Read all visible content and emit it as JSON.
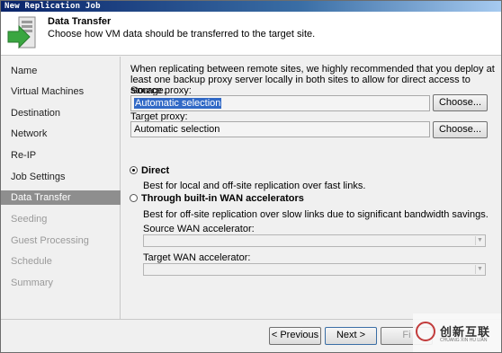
{
  "window": {
    "title": "New Replication Job"
  },
  "header": {
    "title": "Data Transfer",
    "subtitle": "Choose how VM data should be transferred to the target site."
  },
  "sidebar": {
    "items": [
      {
        "label": "Name",
        "state": "normal"
      },
      {
        "label": "Virtual Machines",
        "state": "normal"
      },
      {
        "label": "Destination",
        "state": "normal"
      },
      {
        "label": "Network",
        "state": "normal"
      },
      {
        "label": "Re-IP",
        "state": "normal"
      },
      {
        "label": "Job Settings",
        "state": "normal"
      },
      {
        "label": "Data Transfer",
        "state": "active"
      },
      {
        "label": "Seeding",
        "state": "disabled"
      },
      {
        "label": "Guest Processing",
        "state": "disabled"
      },
      {
        "label": "Schedule",
        "state": "disabled"
      },
      {
        "label": "Summary",
        "state": "disabled"
      }
    ]
  },
  "main": {
    "description": "When replicating between remote sites, we highly recommended that you deploy at least one backup proxy server locally in both sites to allow for direct access to storage.",
    "source_proxy": {
      "label": "Source proxy:",
      "value": "Automatic selection",
      "button": "Choose..."
    },
    "target_proxy": {
      "label": "Target proxy:",
      "value": "Automatic selection",
      "button": "Choose..."
    },
    "direct": {
      "label": "Direct",
      "desc": "Best for local and off-site replication over fast links.",
      "checked": true
    },
    "wan": {
      "label": "Through built-in WAN accelerators",
      "desc": "Best for off-site replication over slow links due to significant bandwidth savings.",
      "checked": false
    },
    "source_wan": {
      "label": "Source WAN accelerator:",
      "value": ""
    },
    "target_wan": {
      "label": "Target WAN accelerator:",
      "value": ""
    }
  },
  "footer": {
    "previous": "< Previous",
    "next": "Next >",
    "finish": "Fi"
  },
  "watermark": {
    "text": "创新互联",
    "sub": "CHUANG XIN HU LIAN"
  },
  "colors": {
    "accent_green": "#3aa640",
    "selection": "#3169c6",
    "active_nav": "#8e8e8e"
  }
}
